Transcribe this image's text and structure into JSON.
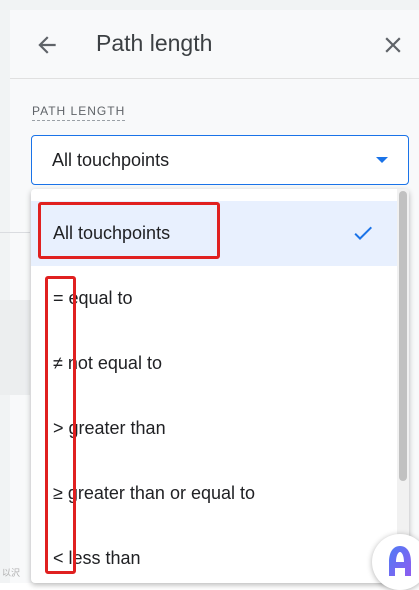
{
  "header": {
    "back_icon": "arrow-back-icon",
    "title": "Path length",
    "close_icon": "close-icon"
  },
  "filter": {
    "section_label": "PATH LENGTH",
    "selected_value": "All touchpoints",
    "caret_icon": "caret-down-icon",
    "accent_color": "#1a73e8"
  },
  "menu": {
    "items": [
      {
        "label": "All touchpoints",
        "selected": true
      },
      {
        "label": "= equal to",
        "selected": false
      },
      {
        "label": "≠ not equal to",
        "selected": false
      },
      {
        "label": "> greater than",
        "selected": false
      },
      {
        "label": "≥ greater than or equal to",
        "selected": false
      },
      {
        "label": "< less than",
        "selected": false
      }
    ],
    "check_icon": "checkmark-icon"
  },
  "annotation_color": "#e02020",
  "fab_icon": "assistant-logo-icon",
  "watermark": "以沢"
}
